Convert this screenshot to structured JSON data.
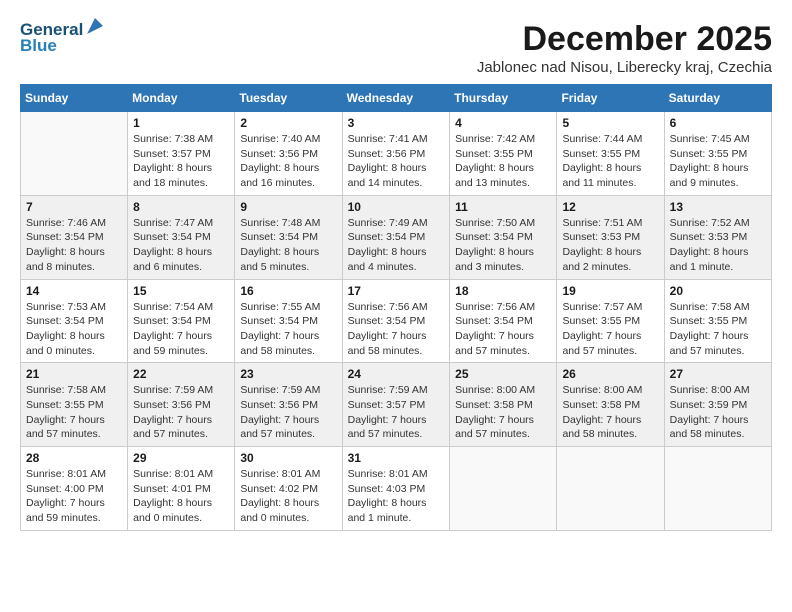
{
  "header": {
    "logo_line1": "General",
    "logo_line2": "Blue",
    "title": "December 2025",
    "subtitle": "Jablonec nad Nisou, Liberecky kraj, Czechia"
  },
  "columns": [
    "Sunday",
    "Monday",
    "Tuesday",
    "Wednesday",
    "Thursday",
    "Friday",
    "Saturday"
  ],
  "weeks": [
    [
      {
        "day": "",
        "info": ""
      },
      {
        "day": "1",
        "info": "Sunrise: 7:38 AM\nSunset: 3:57 PM\nDaylight: 8 hours\nand 18 minutes."
      },
      {
        "day": "2",
        "info": "Sunrise: 7:40 AM\nSunset: 3:56 PM\nDaylight: 8 hours\nand 16 minutes."
      },
      {
        "day": "3",
        "info": "Sunrise: 7:41 AM\nSunset: 3:56 PM\nDaylight: 8 hours\nand 14 minutes."
      },
      {
        "day": "4",
        "info": "Sunrise: 7:42 AM\nSunset: 3:55 PM\nDaylight: 8 hours\nand 13 minutes."
      },
      {
        "day": "5",
        "info": "Sunrise: 7:44 AM\nSunset: 3:55 PM\nDaylight: 8 hours\nand 11 minutes."
      },
      {
        "day": "6",
        "info": "Sunrise: 7:45 AM\nSunset: 3:55 PM\nDaylight: 8 hours\nand 9 minutes."
      }
    ],
    [
      {
        "day": "7",
        "info": "Sunrise: 7:46 AM\nSunset: 3:54 PM\nDaylight: 8 hours\nand 8 minutes."
      },
      {
        "day": "8",
        "info": "Sunrise: 7:47 AM\nSunset: 3:54 PM\nDaylight: 8 hours\nand 6 minutes."
      },
      {
        "day": "9",
        "info": "Sunrise: 7:48 AM\nSunset: 3:54 PM\nDaylight: 8 hours\nand 5 minutes."
      },
      {
        "day": "10",
        "info": "Sunrise: 7:49 AM\nSunset: 3:54 PM\nDaylight: 8 hours\nand 4 minutes."
      },
      {
        "day": "11",
        "info": "Sunrise: 7:50 AM\nSunset: 3:54 PM\nDaylight: 8 hours\nand 3 minutes."
      },
      {
        "day": "12",
        "info": "Sunrise: 7:51 AM\nSunset: 3:53 PM\nDaylight: 8 hours\nand 2 minutes."
      },
      {
        "day": "13",
        "info": "Sunrise: 7:52 AM\nSunset: 3:53 PM\nDaylight: 8 hours\nand 1 minute."
      }
    ],
    [
      {
        "day": "14",
        "info": "Sunrise: 7:53 AM\nSunset: 3:54 PM\nDaylight: 8 hours\nand 0 minutes."
      },
      {
        "day": "15",
        "info": "Sunrise: 7:54 AM\nSunset: 3:54 PM\nDaylight: 7 hours\nand 59 minutes."
      },
      {
        "day": "16",
        "info": "Sunrise: 7:55 AM\nSunset: 3:54 PM\nDaylight: 7 hours\nand 58 minutes."
      },
      {
        "day": "17",
        "info": "Sunrise: 7:56 AM\nSunset: 3:54 PM\nDaylight: 7 hours\nand 58 minutes."
      },
      {
        "day": "18",
        "info": "Sunrise: 7:56 AM\nSunset: 3:54 PM\nDaylight: 7 hours\nand 57 minutes."
      },
      {
        "day": "19",
        "info": "Sunrise: 7:57 AM\nSunset: 3:55 PM\nDaylight: 7 hours\nand 57 minutes."
      },
      {
        "day": "20",
        "info": "Sunrise: 7:58 AM\nSunset: 3:55 PM\nDaylight: 7 hours\nand 57 minutes."
      }
    ],
    [
      {
        "day": "21",
        "info": "Sunrise: 7:58 AM\nSunset: 3:55 PM\nDaylight: 7 hours\nand 57 minutes."
      },
      {
        "day": "22",
        "info": "Sunrise: 7:59 AM\nSunset: 3:56 PM\nDaylight: 7 hours\nand 57 minutes."
      },
      {
        "day": "23",
        "info": "Sunrise: 7:59 AM\nSunset: 3:56 PM\nDaylight: 7 hours\nand 57 minutes."
      },
      {
        "day": "24",
        "info": "Sunrise: 7:59 AM\nSunset: 3:57 PM\nDaylight: 7 hours\nand 57 minutes."
      },
      {
        "day": "25",
        "info": "Sunrise: 8:00 AM\nSunset: 3:58 PM\nDaylight: 7 hours\nand 57 minutes."
      },
      {
        "day": "26",
        "info": "Sunrise: 8:00 AM\nSunset: 3:58 PM\nDaylight: 7 hours\nand 58 minutes."
      },
      {
        "day": "27",
        "info": "Sunrise: 8:00 AM\nSunset: 3:59 PM\nDaylight: 7 hours\nand 58 minutes."
      }
    ],
    [
      {
        "day": "28",
        "info": "Sunrise: 8:01 AM\nSunset: 4:00 PM\nDaylight: 7 hours\nand 59 minutes."
      },
      {
        "day": "29",
        "info": "Sunrise: 8:01 AM\nSunset: 4:01 PM\nDaylight: 8 hours\nand 0 minutes."
      },
      {
        "day": "30",
        "info": "Sunrise: 8:01 AM\nSunset: 4:02 PM\nDaylight: 8 hours\nand 0 minutes."
      },
      {
        "day": "31",
        "info": "Sunrise: 8:01 AM\nSunset: 4:03 PM\nDaylight: 8 hours\nand 1 minute."
      },
      {
        "day": "",
        "info": ""
      },
      {
        "day": "",
        "info": ""
      },
      {
        "day": "",
        "info": ""
      }
    ]
  ]
}
